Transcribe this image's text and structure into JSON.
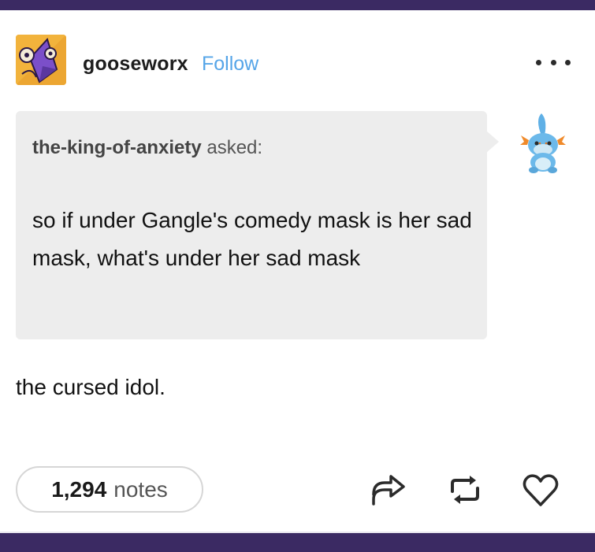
{
  "post": {
    "author": "gooseworx",
    "follow_label": "Follow",
    "more_icon": "more-horizontal-icon",
    "avatar_icon": "avatar-image",
    "ask": {
      "asker": "the-king-of-anxiety",
      "asked_label": "asked:",
      "question": "so if under Gangle's comedy mask is her sad mask, what's under her sad mask",
      "asker_avatar_icon": "mudkip-plush-avatar"
    },
    "answer": "the cursed idol.",
    "notes": {
      "count": "1,294",
      "label": "notes"
    },
    "actions": {
      "share_icon": "share-icon",
      "reblog_icon": "reblog-icon",
      "like_icon": "heart-icon"
    }
  },
  "colors": {
    "frame_bar": "#3b2a63",
    "follow_blue": "#56a5e8",
    "ask_bg": "#ededed"
  }
}
